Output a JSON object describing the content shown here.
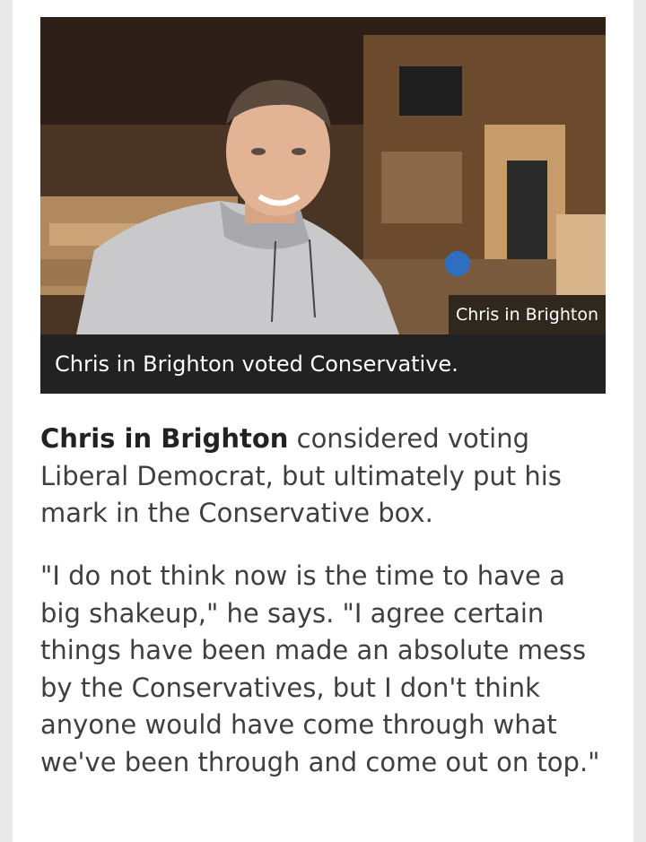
{
  "figure": {
    "photo_credit": "Chris in Brighton",
    "caption": "Chris in Brighton voted Conservative."
  },
  "article": {
    "p1_bold": "Chris in Brighton",
    "p1_rest": " considered voting Liberal Democrat, but ultimately put his mark in the Conservative box.",
    "p2": "\"I do not think now is the time to have a big shakeup,\" he says. \"I agree certain things have been made an absolute mess by the Conservatives, but I don't think anyone would have come through what we've been through and come out on top.\""
  },
  "colors": {
    "caption_bg": "#222222",
    "body_text": "#3f3f42",
    "page_bg": "#ffffff"
  }
}
